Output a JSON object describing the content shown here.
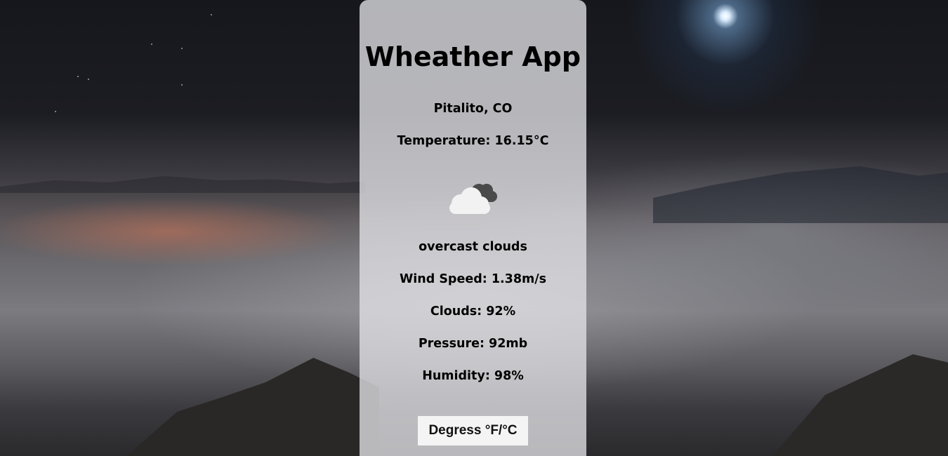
{
  "app": {
    "title": "Wheather App"
  },
  "weather": {
    "location": "Pitalito, CO",
    "temperature": "Temperature: 16.15°C",
    "icon": "overcast-clouds-icon",
    "description": "overcast clouds",
    "wind_speed": "Wind Speed: 1.38m/s",
    "clouds": "Clouds: 92%",
    "pressure": "Pressure: 92mb",
    "humidity": "Humidity: 98%"
  },
  "controls": {
    "toggle_units_label": "Degress °F/°C"
  },
  "colors": {
    "card_background": "#e1e1e6",
    "button_background": "#f4f4f4",
    "text": "#000000"
  }
}
